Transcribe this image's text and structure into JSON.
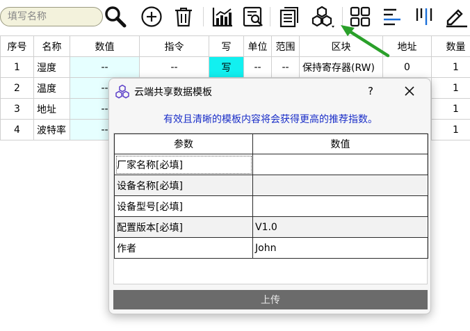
{
  "search": {
    "placeholder": "填写名称"
  },
  "toolbar": {
    "icons": [
      "search-icon",
      "add-icon",
      "delete-icon",
      "chart-icon",
      "inspect-icon",
      "document-icon",
      "hexagons-icon",
      "grid-icon",
      "align-left-icon",
      "align-vertical-icon",
      "edit-icon"
    ]
  },
  "table": {
    "headers": [
      "序号",
      "名称",
      "数值",
      "指令",
      "写",
      "单位",
      "范围",
      "区块",
      "地址",
      "数量"
    ],
    "rows": [
      {
        "index": "1",
        "name": "湿度",
        "value": "--",
        "command": "--",
        "write": "写",
        "unit": "--",
        "range": "--",
        "block": "保持寄存器(RW)",
        "address": "0",
        "count": "1"
      },
      {
        "index": "2",
        "name": "温度",
        "value": "--",
        "count": "1"
      },
      {
        "index": "3",
        "name": "地址",
        "value": "--",
        "count": "1"
      },
      {
        "index": "4",
        "name": "波特率",
        "value": "--",
        "count": "1"
      }
    ]
  },
  "dialog": {
    "title": "云端共享数据模板",
    "help": "?",
    "hint": "有效且清晰的模板内容将会获得更高的推荐指数。",
    "columns": [
      "参数",
      "数值"
    ],
    "rows": [
      {
        "param": "厂家名称[必填]",
        "value": ""
      },
      {
        "param": "设备名称[必填]",
        "value": ""
      },
      {
        "param": "设备型号[必填]",
        "value": ""
      },
      {
        "param": "配置版本[必填]",
        "value": "V1.0"
      },
      {
        "param": "作者",
        "value": "John"
      }
    ],
    "upload_label": "上传"
  },
  "colors": {
    "write_cell": "#12f0f0",
    "value_cell": "#e6ffff",
    "hint_text": "#1a2ec8",
    "annotation_arrow": "#2aa02a",
    "upload_button": "#6b6b6b"
  }
}
